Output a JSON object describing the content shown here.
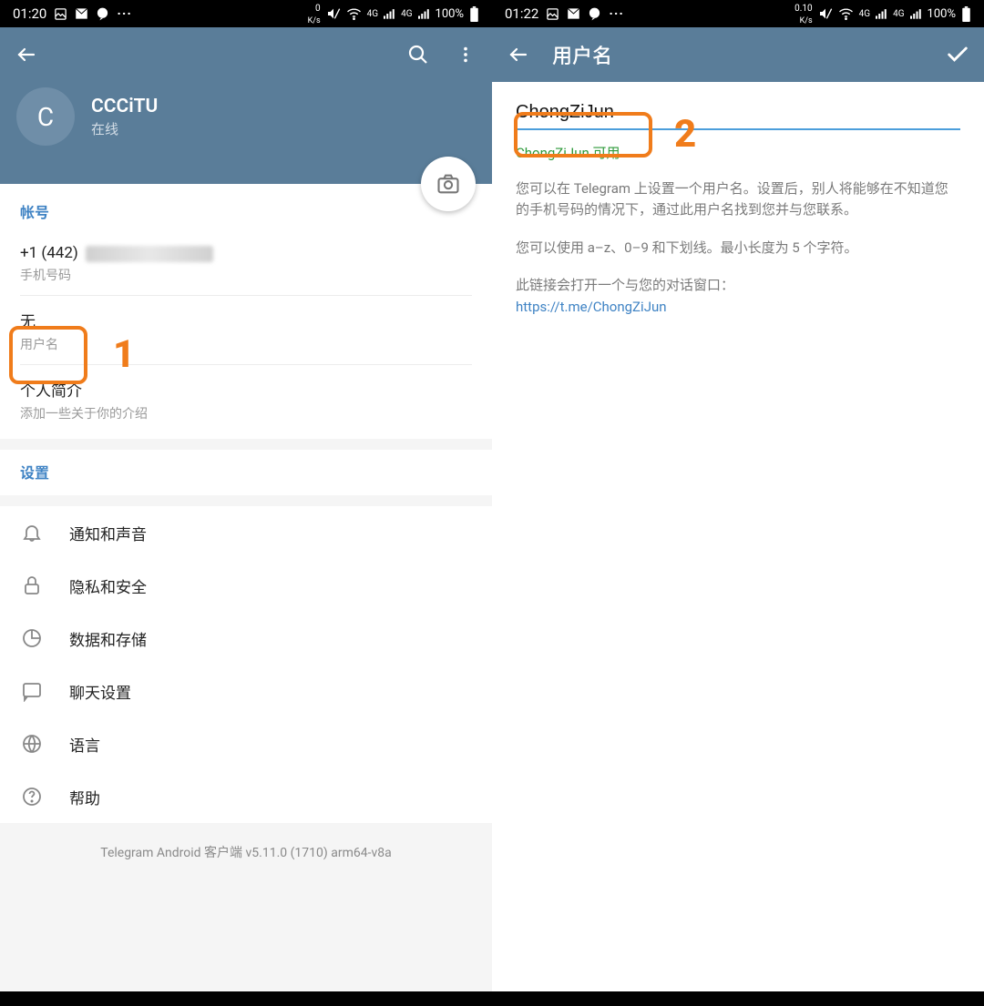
{
  "annotations": {
    "num1": "1",
    "num2": "2"
  },
  "left": {
    "status": {
      "time": "01:20",
      "speed": "0",
      "speed_unit": "K/s",
      "net": "4G",
      "battery": "100%"
    },
    "profile": {
      "avatar_initial": "C",
      "name": "CCCiTU",
      "status": "在线"
    },
    "account": {
      "section_title": "帐号",
      "phone_prefix": "+1 (442)",
      "phone_label": "手机号码",
      "username_value": "无",
      "username_label": "用户名",
      "bio_title": "个人简介",
      "bio_hint": "添加一些关于你的介绍"
    },
    "settings": {
      "section_title": "设置",
      "items": [
        {
          "label": "通知和声音"
        },
        {
          "label": "隐私和安全"
        },
        {
          "label": "数据和存储"
        },
        {
          "label": "聊天设置"
        },
        {
          "label": "语言"
        },
        {
          "label": "帮助"
        }
      ]
    },
    "version": "Telegram Android 客户端 v5.11.0 (1710) arm64-v8a"
  },
  "right": {
    "status": {
      "time": "01:22",
      "speed": "0.10",
      "speed_unit": "K/s",
      "net": "4G",
      "battery": "100%"
    },
    "appbar_title": "用户名",
    "username_value": "ChongZiJun",
    "availability": "ChongZiJun 可用",
    "desc1": "您可以在 Telegram 上设置一个用户名。设置后，别人将能够在不知道您的手机号码的情况下，通过此用户名找到您并与您联系。",
    "desc2": "您可以使用 a–z、0–9 和下划线。最小长度为 5 个字符。",
    "link_intro": "此链接会打开一个与您的对话窗口：",
    "link": "https://t.me/ChongZiJun"
  }
}
